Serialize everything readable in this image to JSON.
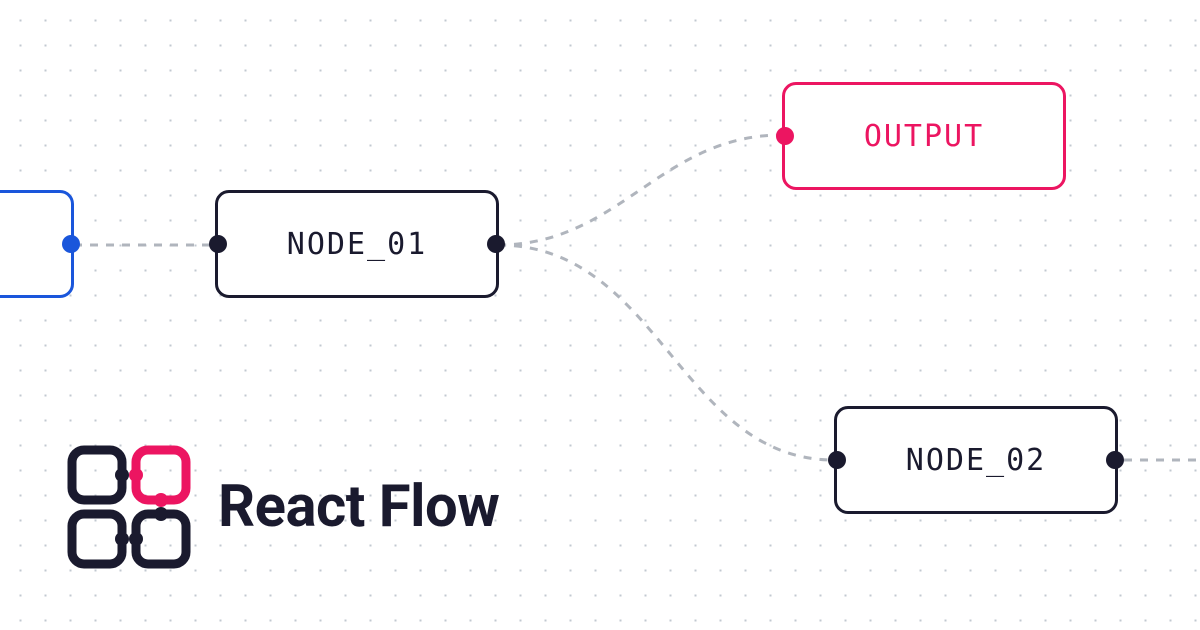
{
  "brand": {
    "name": "React Flow"
  },
  "colors": {
    "blue": "#1a56db",
    "dark": "#1a1a2e",
    "pink": "#ec1561",
    "edge": "#b0b5bd"
  },
  "nodes": {
    "input": {
      "label": ""
    },
    "node01": {
      "label": "NODE_01"
    },
    "output": {
      "label": "OUTPUT"
    },
    "node02": {
      "label": "NODE_02"
    }
  }
}
